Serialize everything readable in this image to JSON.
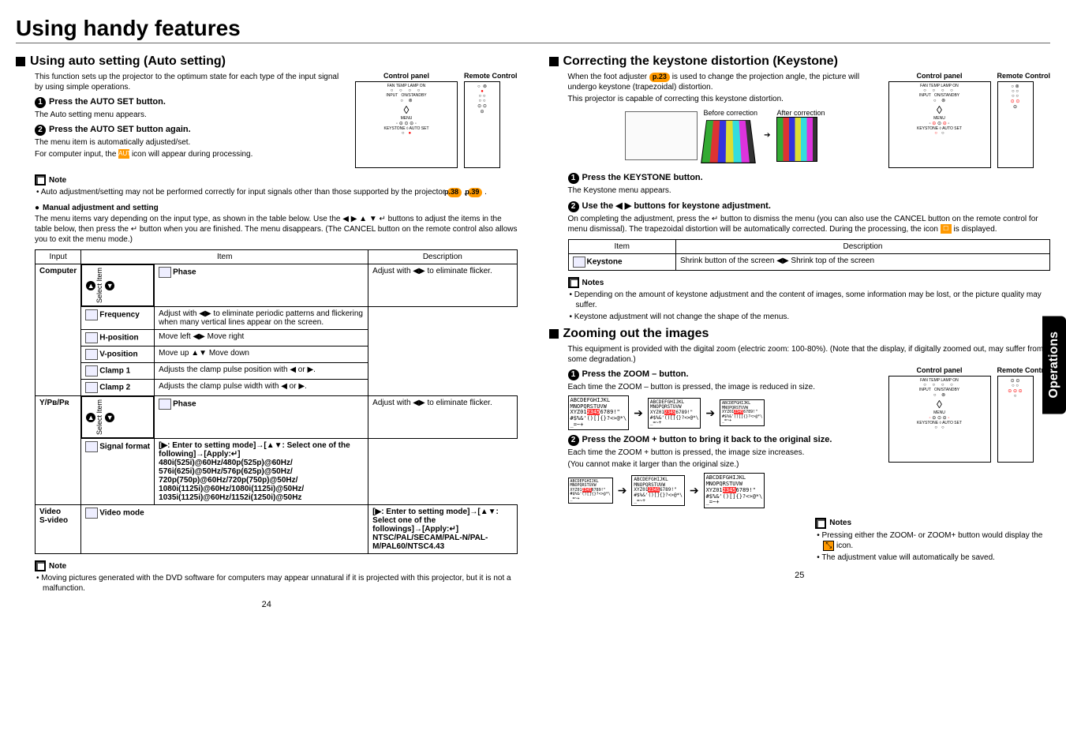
{
  "mainTitle": "Using handy features",
  "left": {
    "sec1": {
      "title": "Using auto setting (Auto setting)",
      "intro": "This function sets up the projector to the optimum state for each type of the input signal by using simple operations.",
      "panelLabel": "Control panel",
      "remoteLabel": "Remote Control",
      "step1t": "Press the AUTO SET button.",
      "step1b": "The Auto setting menu appears.",
      "step2t": "Press the AUTO SET button again.",
      "step2b1": "The menu item is automatically adjusted/set.",
      "step2b2a": "For computer input, the ",
      "step2b2b": " icon will appear during processing.",
      "autoIcon": "AUTO",
      "noteH": "Note",
      "noteB": "Auto adjustment/setting may not be performed correctly for input signals other than those supported by the projector ",
      "p38": "p.38",
      "p39": "p.39",
      "manualH": "Manual adjustment and setting",
      "manualB": "The menu items vary depending on the input type, as shown in the table below. Use the ◀ ▶ ▲ ▼ ↵ buttons to adjust the items in the table below, then press the ↵ button when you are finished. The menu disappears. (The CANCEL button on the remote control also allows you to exit the menu mode.)",
      "th": {
        "input": "Input",
        "item": "Item",
        "desc": "Description",
        "sel": "Select Item"
      },
      "rows": [
        {
          "input": "Computer",
          "item": "Phase",
          "desc": "Adjust with ◀▶ to eliminate flicker."
        },
        {
          "input": "",
          "item": "Frequency",
          "desc": "Adjust with ◀▶ to eliminate periodic patterns and flickering when many vertical lines appear on the screen."
        },
        {
          "input": "",
          "item": "H-position",
          "desc": "Move left ◀▶ Move right"
        },
        {
          "input": "",
          "item": "V-position",
          "desc": "Move up ▲▼ Move down"
        },
        {
          "input": "",
          "item": "Clamp 1",
          "desc": "Adjusts the clamp pulse position with ◀ or ▶."
        },
        {
          "input": "",
          "item": "Clamp 2",
          "desc": "Adjusts the clamp pulse width with ◀ or ▶."
        },
        {
          "input": "Y/Pʙ/Pʀ",
          "item": "Phase",
          "desc": "Adjust with ◀▶ to eliminate flicker."
        },
        {
          "input": "",
          "item": "Signal format",
          "desc": "[▶: Enter to setting mode]→[▲▼: Select one of the following]→[Apply:↵]\n480i(525i)@60Hz/480p(525p)@60Hz/\n576i(625i)@50Hz/576p(625p)@50Hz/\n720p(750p)@60Hz/720p(750p)@50Hz/\n1080i(1125i)@60Hz/1080i(1125i)@50Hz/\n1035i(1125i)@60Hz/1152i(1250i)@50Hz"
        },
        {
          "input": "Video\nS-video",
          "item": "Video mode",
          "desc": "[▶: Enter to setting mode]→[▲▼: Select one of the followings]→[Apply:↵]\nNTSC/PAL/SECAM/PAL-N/PAL-M/PAL60/NTSC4.43"
        }
      ],
      "note2H": "Note",
      "note2B": "Moving pictures generated with the DVD software for computers may appear unnatural if it is projected with this projector, but it is not a malfunction.",
      "pnum": "24"
    }
  },
  "right": {
    "kst": {
      "title": "Correcting the keystone distortion (Keystone)",
      "intro1": "When the foot adjuster ",
      "p23": "p.23",
      "intro2": " is used to change the projection angle, the picture will undergo keystone (trapezoidal) distortion.",
      "intro3": "This projector is capable of correcting this keystone distortion.",
      "beforeL": "Before correction",
      "afterL": "After correction",
      "panelLabel": "Control panel",
      "remoteLabel": "Remote Control",
      "step1t": "Press the KEYSTONE button.",
      "step1b": "The Keystone menu appears.",
      "step2t": "Use the ◀ ▶ buttons for keystone adjustment.",
      "step2b1": "On completing the adjustment, press the ↵ button to dismiss the menu (you can also use the CANCEL button on the remote control for menu dismissal). The trapezoidal distortion will be automatically corrected. During the processing, the icon ",
      "step2b2": " is displayed.",
      "icon": "☐",
      "th": {
        "item": "Item",
        "desc": "Description"
      },
      "row": {
        "item": "Keystone",
        "desc": "Shrink button of the screen ◀▶ Shrink top of the screen"
      },
      "notesH": "Notes",
      "note1": "Depending on the amount of keystone adjustment and the content of images, some information may be lost, or the picture quality may suffer.",
      "note2": "Keystone adjustment will not change the shape of the menus."
    },
    "zoom": {
      "title": "Zooming out the images",
      "intro": "This equipment is provided with the digital zoom (electric zoom: 100-80%). (Note that the display, if digitally zoomed out, may suffer from some degradation.)",
      "step1t": "Press the ZOOM – button.",
      "step1b": "Each time the ZOOM – button is pressed, the image is reduced in size.",
      "step2t": "Press the ZOOM + button to bring it back to the original size.",
      "step2b1": "Each time the ZOOM + button is pressed, the image size increases.",
      "step2b2": "(You cannot make it larger than the original size.)",
      "panelLabel": "Control panel",
      "remoteLabel": "Remote Control",
      "sampleL1": "ABCDEFGHIJKL",
      "sampleL2": "MNOPQRSTUVW",
      "sampleL3a": "XYZ01",
      "sampleL3b": "2345",
      "sampleL3c": "6789!\"",
      "sampleL4": "#$%&'()[]{}?<>@*\\",
      "sampleL5": "_=~+",
      "notesH": "Notes",
      "note1a": "Pressing either the ZOOM- or ZOOM+ button would display the ",
      "note1b": " icon.",
      "noteIcon": "⤡",
      "note2": "The adjustment value will automatically be saved.",
      "pnum": "25"
    }
  },
  "sideTab": "Operations"
}
